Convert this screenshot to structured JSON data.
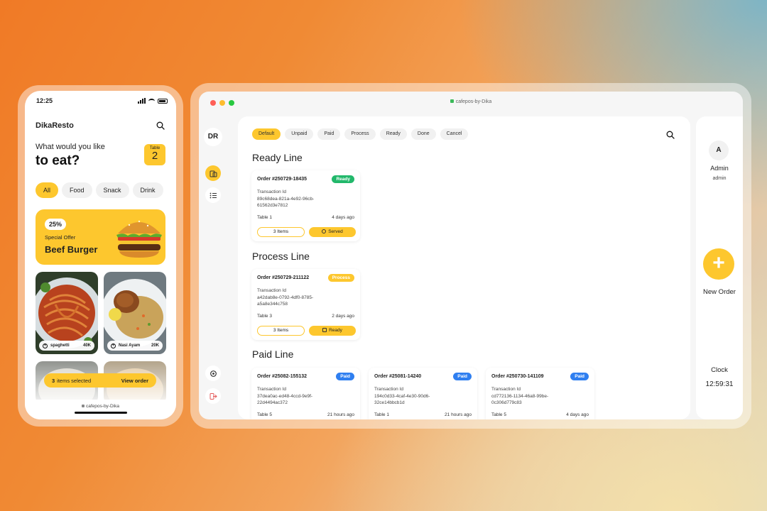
{
  "phone": {
    "status_time": "12:25",
    "brand": "DikaResto",
    "greeting": "What would you like",
    "greeting_big": "to eat?",
    "table_label": "Table",
    "table_number": "2",
    "categories": [
      {
        "label": "All",
        "active": true
      },
      {
        "label": "Food",
        "active": false
      },
      {
        "label": "Snack",
        "active": false
      },
      {
        "label": "Drink",
        "active": false
      }
    ],
    "offer": {
      "percent": "25%",
      "subtitle": "Special Offer",
      "title": "Beef Burger"
    },
    "foods": [
      {
        "name": "spaghetti",
        "price": "40K"
      },
      {
        "name": "Nasi Ayam",
        "price": "20K"
      }
    ],
    "order_bar": {
      "count": "3",
      "text": "items selected",
      "action": "View order"
    },
    "footer": "cafepos-by-Dika"
  },
  "browser": {
    "url": "cafepos-by-Dika",
    "dot_colors": [
      "#ff5f57",
      "#febc2e",
      "#28c840"
    ],
    "accent": "#fdc72e",
    "rail": {
      "avatar": "DR"
    },
    "filters": [
      {
        "label": "Default",
        "active": true
      },
      {
        "label": "Unpaid",
        "active": false
      },
      {
        "label": "Paid",
        "active": false
      },
      {
        "label": "Process",
        "active": false
      },
      {
        "label": "Ready",
        "active": false
      },
      {
        "label": "Done",
        "active": false
      },
      {
        "label": "Cancel",
        "active": false
      }
    ],
    "sections": {
      "ready": "Ready Line",
      "process": "Process Line",
      "paid": "Paid Line"
    },
    "ready_orders": [
      {
        "id": "Order #250729-18435",
        "status": "Ready",
        "status_color": "#22b86b",
        "tlabel": "Transaction Id",
        "tid": "89c68dea-821a-4e92-96cb-61562d3e7812",
        "table": "Table 1",
        "time": "4 days ago",
        "items": "3 Items",
        "action": "Served"
      }
    ],
    "process_orders": [
      {
        "id": "Order #250729-211122",
        "status": "Process",
        "status_color": "#fdc72e",
        "tlabel": "Transaction Id",
        "tid": "a42dab8e-0792-4df0-8785-a5a8e344c758",
        "table": "Table 3",
        "time": "2 days ago",
        "items": "3 Items",
        "action": "Ready"
      }
    ],
    "paid_orders": [
      {
        "id": "Order #25082-155132",
        "status": "Paid",
        "status_color": "#2f7ff0",
        "tlabel": "Transaction Id",
        "tid": "37dea0ac-ed48-4ccd-9e9f-22d4494ac372",
        "table": "Table 5",
        "time": "21 hours ago"
      },
      {
        "id": "Order #25081-14240",
        "status": "Paid",
        "status_color": "#2f7ff0",
        "tlabel": "Transaction Id",
        "tid": "194c0d33-4caf-4e30-90d6-32ce14bbcb1d",
        "table": "Table 1",
        "time": "21 hours ago"
      },
      {
        "id": "Order #250730-141109",
        "status": "Paid",
        "status_color": "#2f7ff0",
        "tlabel": "Transaction Id",
        "tid": "cd772136-1134-46a8-99be-0c306d779c83",
        "table": "Table 5",
        "time": "4 days ago"
      }
    ],
    "user": {
      "avatar": "A",
      "name": "Admin",
      "role": "admin"
    },
    "new_order": {
      "icon": "+",
      "label": "New Order"
    },
    "clock": {
      "label": "Clock",
      "time": "12:59:31"
    }
  }
}
